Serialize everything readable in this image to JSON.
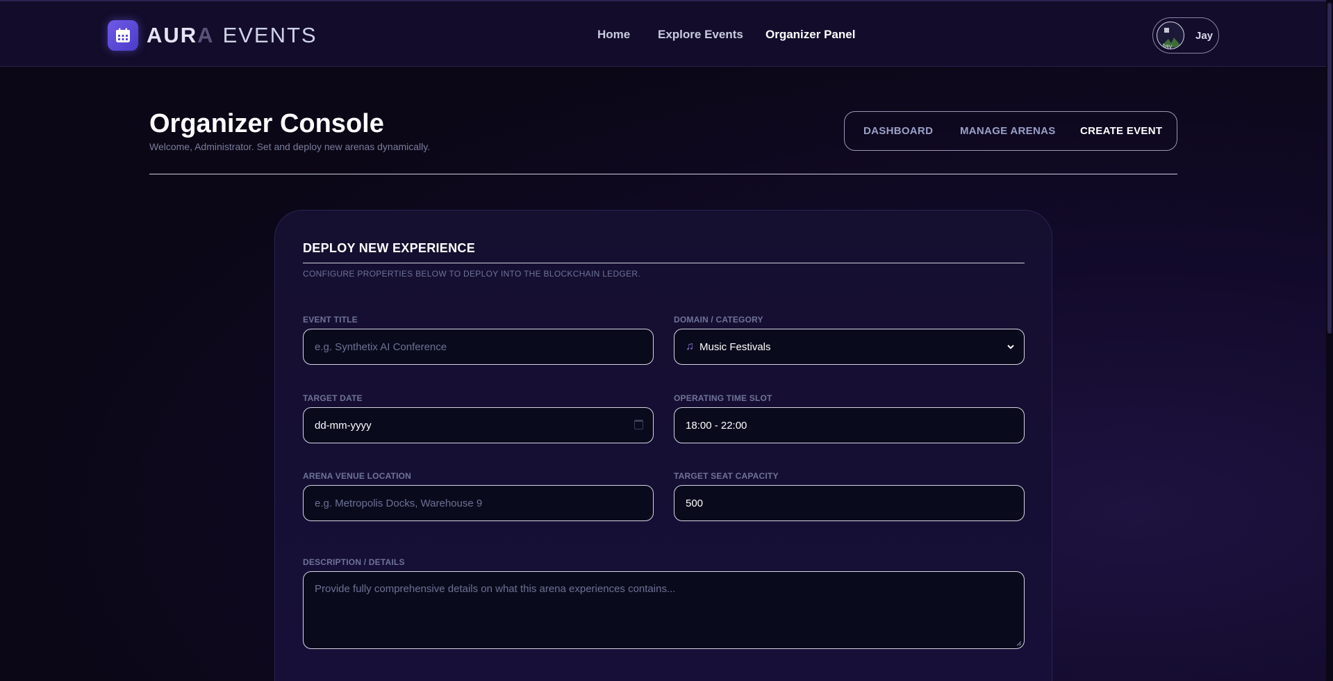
{
  "brand": {
    "name_bold": "AUR",
    "name_fade": "A",
    "name_light": "EVENTS",
    "icon": "calendar-icon"
  },
  "nav": {
    "home": "Home",
    "explore": "Explore Events",
    "organizer": "Organizer Panel"
  },
  "user": {
    "name": "Jay",
    "avatar_alt": "Jay"
  },
  "header": {
    "title": "Organizer Console",
    "subtitle": "Welcome, Administrator. Set and deploy new arenas dynamically."
  },
  "tabs": {
    "dashboard": "DASHBOARD",
    "manage": "MANAGE ARENAS",
    "create": "CREATE EVENT"
  },
  "form": {
    "title": "DEPLOY NEW EXPERIENCE",
    "subtitle": "CONFIGURE PROPERTIES BELOW TO DEPLOY INTO THE BLOCKCHAIN LEDGER.",
    "event_title": {
      "label": "EVENT TITLE",
      "placeholder": "e.g. Synthetix AI Conference"
    },
    "category": {
      "label": "DOMAIN / CATEGORY",
      "value": "Music Festivals",
      "icon": "music-note-icon"
    },
    "date": {
      "label": "TARGET DATE",
      "value": "dd-mm-yyyy"
    },
    "time": {
      "label": "OPERATING TIME SLOT",
      "value": "18:00 - 22:00"
    },
    "venue": {
      "label": "ARENA VENUE LOCATION",
      "placeholder": "e.g. Metropolis Docks, Warehouse 9"
    },
    "capacity": {
      "label": "TARGET SEAT CAPACITY",
      "value": "500"
    },
    "description": {
      "label": "DESCRIPTION / DETAILS",
      "placeholder": "Provide fully comprehensive details on what this arena experiences contains..."
    }
  },
  "colors": {
    "accent": "#6e5ae8",
    "background": "#0b0716",
    "card": "#150f30"
  }
}
